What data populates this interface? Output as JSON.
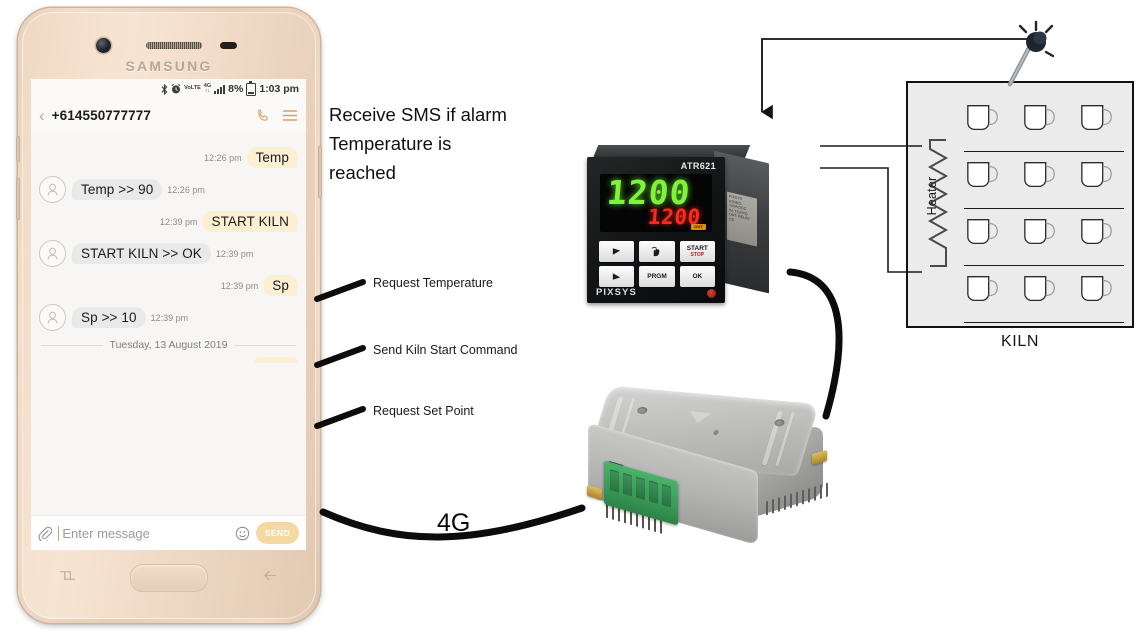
{
  "phone": {
    "brand": "SAMSUNG",
    "status_bar": {
      "volte_label": "VoLTE",
      "network_label": "4G",
      "battery_percent": "8%",
      "time": "1:03 pm"
    },
    "conversation": {
      "contact_number": "+614550777777",
      "messages": [
        {
          "direction": "out",
          "text": "Temp",
          "time": "12:26 pm"
        },
        {
          "direction": "in",
          "text": "Temp >> 90",
          "time": "12:26 pm"
        },
        {
          "direction": "out",
          "text": "START KILN",
          "time": "12:39 pm"
        },
        {
          "direction": "in",
          "text": "START KILN >> OK",
          "time": "12:39 pm"
        },
        {
          "direction": "out",
          "text": "Sp",
          "time": "12:39 pm"
        },
        {
          "direction": "in",
          "text": "Sp >> 10",
          "time": "12:39 pm"
        }
      ],
      "date_separator": "Tuesday, 13 August 2019"
    },
    "composer": {
      "placeholder": "Enter message",
      "send_label": "SEND"
    }
  },
  "annotations": {
    "headline": "Receive SMS if alarm\nTemperature is\nreached",
    "headline_lines": [
      "Receive SMS if alarm",
      "Temperature is",
      "reached"
    ],
    "callouts": [
      "Request Temperature",
      "Send Kiln Start Command",
      "Request Set Point"
    ],
    "network_label": "4G"
  },
  "controller": {
    "model": "ATR621",
    "brand": "PIXSYS",
    "display_primary": "1200",
    "display_secondary": "1200",
    "out_indicator": "OUT",
    "keys": [
      {
        "label": "",
        "icon": "up-arrow-icon"
      },
      {
        "label": "",
        "icon": "hand-icon"
      },
      {
        "label": "START",
        "sub": "STOP"
      },
      {
        "label": "",
        "icon": "down-arrow-icon"
      },
      {
        "label": "PRGM",
        "sub": ""
      },
      {
        "label": "OK",
        "sub": ""
      }
    ]
  },
  "kiln": {
    "title": "KILN",
    "heater_label": "Heater",
    "shelf_count": 4,
    "cups_per_shelf": 3
  },
  "colors": {
    "phone_body": "#edd6c1",
    "accent_gold": "#d9a066",
    "bubble_out": "#fcefd2",
    "bubble_in": "#e9e9e9",
    "display_green": "#7ef53a",
    "display_red": "#ff2a1c",
    "terminal_green": "#3a9c57",
    "kiln_fill": "#ebebeb",
    "wire_black": "#111111"
  }
}
